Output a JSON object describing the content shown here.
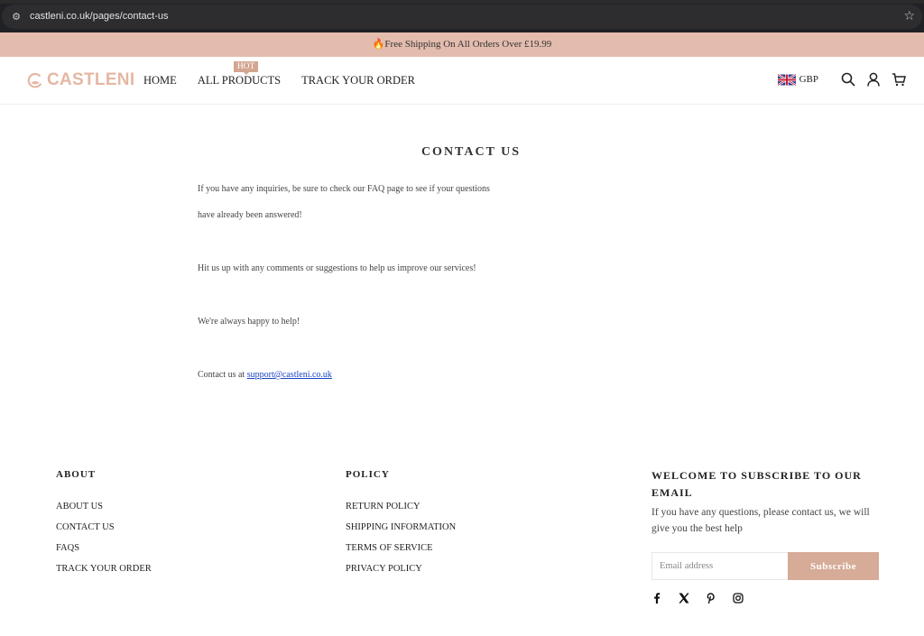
{
  "browser": {
    "url": "castleni.co.uk/pages/contact-us"
  },
  "announcement": {
    "icon": "🔥",
    "text": "Free Shipping On All Orders Over £19.99"
  },
  "header": {
    "logo_text": "CASTLENI",
    "nav": [
      {
        "label": "HOME"
      },
      {
        "label": "ALL PRODUCTS",
        "badge": "HOT"
      },
      {
        "label": "TRACK YOUR ORDER"
      }
    ],
    "currency": "GBP",
    "icons": [
      "uk-flag-icon",
      "search-icon",
      "account-icon",
      "cart-icon"
    ]
  },
  "main": {
    "title": "CONTACT US",
    "paragraphs": [
      "If you have any inquiries, be sure to check our FAQ page to see if your questions",
      "have already been answered!",
      "Hit us up with any comments or suggestions to help us improve our services!",
      "We're always happy to help!"
    ],
    "contact_prefix": "Contact us at ",
    "contact_email": "support@castleni.co.uk"
  },
  "footer": {
    "about": {
      "heading": "ABOUT",
      "links": [
        "ABOUT US",
        "CONTACT US",
        "FAQS",
        "TRACK YOUR ORDER"
      ]
    },
    "policy": {
      "heading": "POLICY",
      "links": [
        "RETURN POLICY",
        "SHIPPING INFORMATION",
        "TERMS OF SERVICE",
        "PRIVACY POLICY"
      ]
    },
    "subscribe": {
      "heading": "WELCOME TO SUBSCRIBE TO OUR EMAIL",
      "description": "If you have any questions, please contact us, we will give you the best help",
      "email_placeholder": "Email address",
      "button_label": "Subscribe",
      "socials": [
        "facebook-icon",
        "x-icon",
        "pinterest-icon",
        "instagram-icon"
      ]
    }
  },
  "colors": {
    "announcement_bg": "#e3bcad",
    "brand": "#e5b7a3",
    "badge": "#d4a590",
    "button": "#d6ab98",
    "link": "#1a44c4"
  }
}
